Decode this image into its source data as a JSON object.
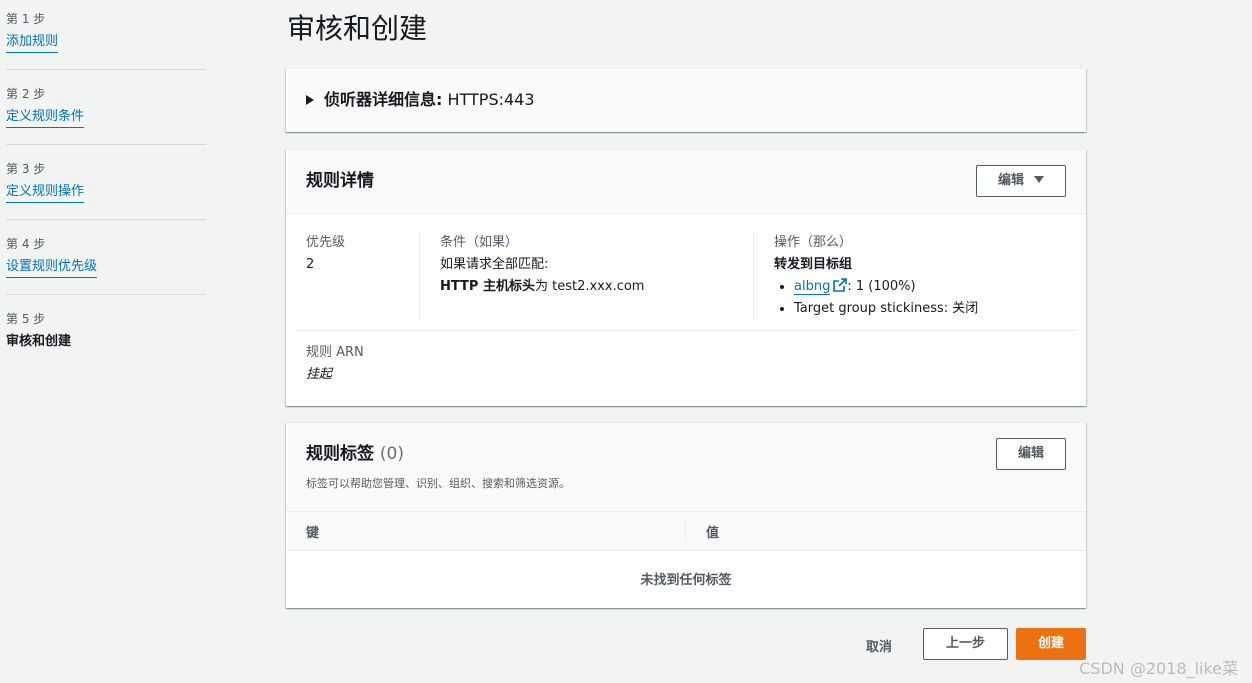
{
  "steps": [
    {
      "label": "第 1 步",
      "name": "添加规则"
    },
    {
      "label": "第 2 步",
      "name": "定义规则条件"
    },
    {
      "label": "第 3 步",
      "name": "定义规则操作"
    },
    {
      "label": "第 4 步",
      "name": "设置规则优先级"
    },
    {
      "label": "第 5 步",
      "name": "审核和创建"
    }
  ],
  "page": {
    "title": "审核和创建"
  },
  "listener": {
    "label": "侦听器详细信息:",
    "value": "HTTPS:443"
  },
  "rule_details": {
    "title": "规则详情",
    "edit_label": "编辑",
    "priority_label": "优先级",
    "priority_value": "2",
    "condition_label": "条件（如果）",
    "condition_match": "如果请求全部匹配:",
    "condition_field": "HTTP 主机标头",
    "condition_op": "为",
    "condition_value": "test2.xxx.com",
    "action_label": "操作（那么）",
    "action_title": "转发到目标组",
    "target_group": "albng",
    "target_weight": ": 1 (100%)",
    "stickiness": "Target group stickiness: 关闭",
    "arn_label": "规则 ARN",
    "arn_value": "挂起"
  },
  "rule_tags": {
    "title": "规则标签",
    "count": "(0)",
    "edit_label": "编辑",
    "description": "标签可以帮助您管理、识别、组织、搜索和筛选资源。",
    "col_key": "键",
    "col_value": "值",
    "empty": "未找到任何标签"
  },
  "footer": {
    "cancel": "取消",
    "previous": "上一步",
    "create": "创建"
  },
  "watermark": "CSDN @2018_like菜",
  "colors": {
    "link": "#0073bb",
    "primary": "#ec7211",
    "background": "#f2f3f3"
  }
}
